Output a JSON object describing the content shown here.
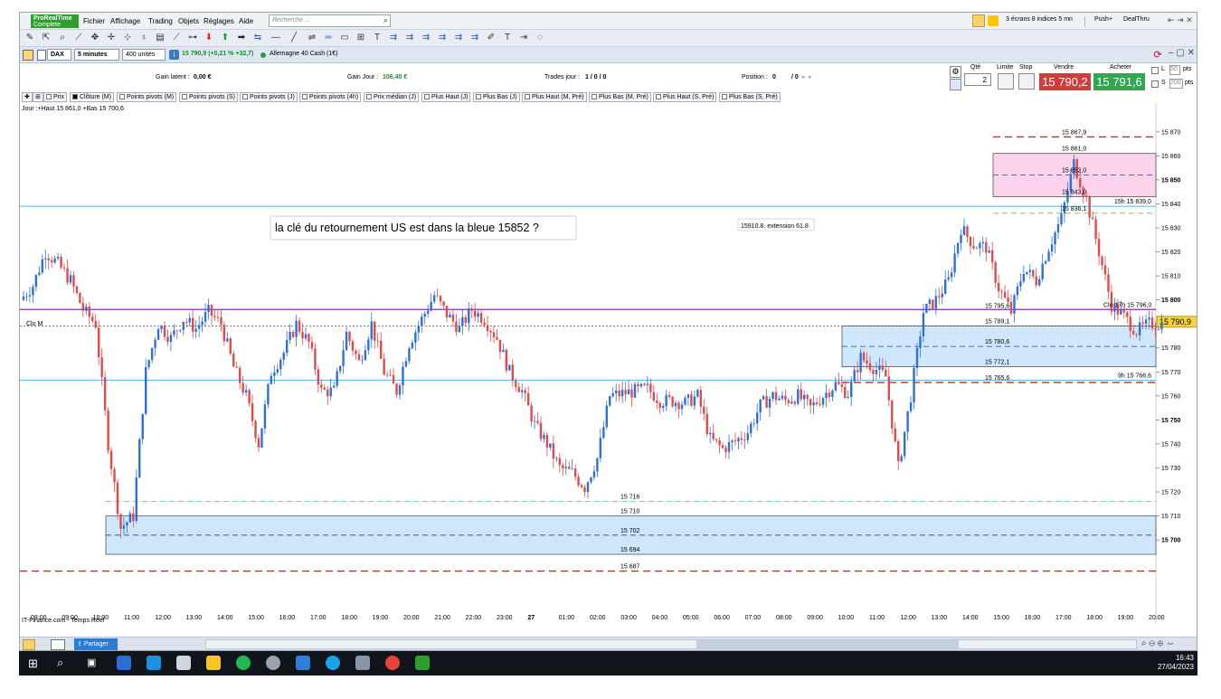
{
  "app": {
    "logo_line1": "ProRealTime",
    "logo_line2": "Complete"
  },
  "menu": [
    "Fichier",
    "Affichage",
    "Trading",
    "Objets",
    "Réglages",
    "Aide"
  ],
  "search": {
    "placeholder": "Recherche ..."
  },
  "topright": {
    "layout": "3 écrans 8 indices 5 mn",
    "push": "Push+",
    "dealthru": "DealThru"
  },
  "instrument": {
    "name": "DAX",
    "timeframe": "5 minutes",
    "units": "400 unités",
    "price_text": "15 790,9 (+0,21 % +32,7)",
    "market": "Allemagne 40 Cash (1€)"
  },
  "info": {
    "gain_latent_label": "Gain latent :",
    "gain_latent": "0,00 €",
    "gain_jour_label": "Gain Jour :",
    "gain_jour": "106,40 €",
    "trades_label": "Trades jour :",
    "trades": "1 / 0 / 0",
    "position_label": "Position :",
    "position": "0",
    "position2": "/ 0"
  },
  "order": {
    "qty_label": "Qté",
    "qty": "2",
    "limit_label": "Limite",
    "stop_label": "Stop",
    "sell_label": "Vendre",
    "buy_label": "Acheter",
    "sell_price": "15 790,2",
    "buy_price": "15 791,6",
    "l_label": "L",
    "l_val": "50",
    "l_unit": "pts",
    "s_label": "S",
    "s_val": "200",
    "s_unit": "pts"
  },
  "indicators": [
    "Prix",
    "Clôture (M)",
    "Points pivots (M)",
    "Points pivots (S)",
    "Points pivots (J)",
    "Points pivots (4h)",
    "Prix médian (J)",
    "Plus Haut (J)",
    "Plus Bas (J)",
    "Plus Haut (M, Pré)",
    "Plus Bas (M, Pré)",
    "Plus Haut (S, Pré)",
    "Plus Bas (S, Pré)"
  ],
  "jour_label": "Jour :+Haut 15 861,0 +Bas 15 700,6",
  "annotation": "la clé du retournement US est dans la bleue 15852 ?",
  "ext_label": "15910.8. extension 61.8",
  "clo_m": "Clo M",
  "source": "IT-Finance.com - Temps Réel",
  "levels": [
    {
      "label": "15 867,9",
      "price": 15867.9
    },
    {
      "label": "15 861,0",
      "price": 15861.0
    },
    {
      "label": "15 852,0",
      "price": 15852.0
    },
    {
      "label": "15 843,0",
      "price": 15843.0
    },
    {
      "label": "15h 15 839,0",
      "price": 15839.0
    },
    {
      "label": "15 836,1",
      "price": 15836.1
    },
    {
      "label": "15 795,6",
      "price": 15795.6
    },
    {
      "label": "Clo 17h 15 796,0",
      "price": 15796.0
    },
    {
      "label": "15 789,1",
      "price": 15789.1
    },
    {
      "label": "15 780,6",
      "price": 15780.6
    },
    {
      "label": "15 772,1",
      "price": 15772.1
    },
    {
      "label": "9h 15 766,6",
      "price": 15766.6
    },
    {
      "label": "15 765,6",
      "price": 15765.6
    },
    {
      "label": "15 716",
      "price": 15716
    },
    {
      "label": "15 710",
      "price": 15710
    },
    {
      "label": "15 702",
      "price": 15702
    },
    {
      "label": "15 694",
      "price": 15694
    },
    {
      "label": "15 687",
      "price": 15687
    }
  ],
  "chart_data": {
    "type": "candlestick",
    "y_ticks": [
      "15 870",
      "15 860",
      "15 850",
      "15 840",
      "15 830",
      "15 820",
      "15 810",
      "15 800",
      "15 790",
      "15 780",
      "15 770",
      "15 760",
      "15 750",
      "15 740",
      "15 730",
      "15 720",
      "15 710",
      "15 700"
    ],
    "ylim": [
      15665,
      15882
    ],
    "x_ticks": [
      "08:00",
      "09:00",
      "10:00",
      "11:00",
      "12:00",
      "13:00",
      "14:00",
      "15:00",
      "16:00",
      "17:00",
      "18:00",
      "19:00",
      "20:00",
      "21:00",
      "22:00",
      "23:00",
      "27",
      "01:00",
      "02:00",
      "03:00",
      "04:00",
      "05:00",
      "06:00",
      "07:00",
      "08:00",
      "09:00",
      "10:00",
      "11:00",
      "12:00",
      "13:00",
      "14:00",
      "15:00",
      "16:00",
      "17:00",
      "18:00",
      "19:00",
      "20:00"
    ],
    "current_price": "15 790,9",
    "closes": [
      15800,
      15806,
      15820,
      15815,
      15808,
      15796,
      15790,
      15740,
      15705,
      15710,
      15770,
      15790,
      15784,
      15792,
      15788,
      15795,
      15790,
      15772,
      15760,
      15740,
      15770,
      15778,
      15790,
      15782,
      15762,
      15762,
      15786,
      15774,
      15790,
      15770,
      15762,
      15782,
      15792,
      15802,
      15794,
      15788,
      15796,
      15792,
      15784,
      15770,
      15762,
      15748,
      15740,
      15730,
      15728,
      15722,
      15734,
      15760,
      15761,
      15762,
      15763,
      15758,
      15758,
      15757,
      15760,
      15742,
      15738,
      15741,
      15745,
      15756,
      15760,
      15758,
      15760,
      15755,
      15760,
      15765,
      15761,
      15776,
      15772,
      15768,
      15730,
      15760,
      15795,
      15800,
      15808,
      15830,
      15823,
      15822,
      15805,
      15795,
      15813,
      15808,
      15822,
      15834,
      15857,
      15842,
      15820,
      15798,
      15793,
      15787,
      15790
    ]
  },
  "bottom": {
    "share": "Partager"
  },
  "taskbar": {
    "time": "16:43",
    "date": "27/04/2023"
  }
}
